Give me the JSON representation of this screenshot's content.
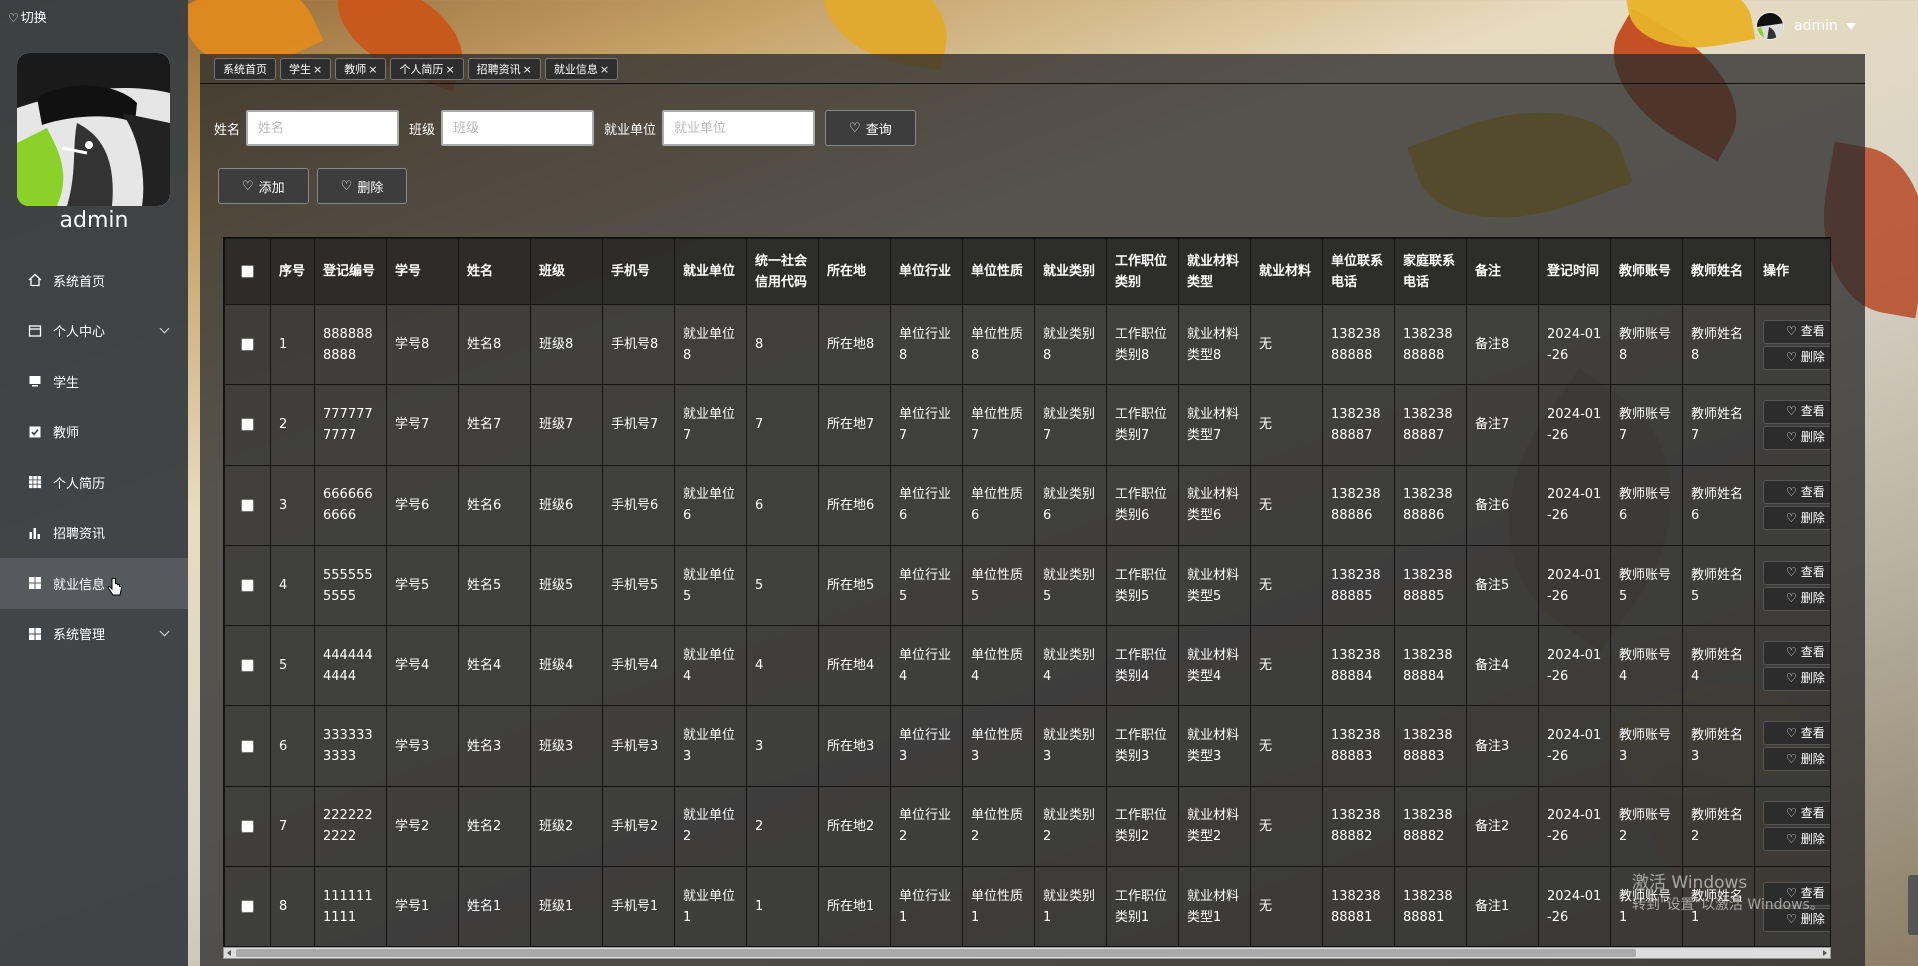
{
  "sidebar": {
    "switch_label": "切换",
    "username": "admin",
    "items": [
      {
        "label": "系统首页",
        "icon": "home-icon"
      },
      {
        "label": "个人中心",
        "icon": "profile-icon",
        "has_submenu": true
      },
      {
        "label": "学生",
        "icon": "monitor-icon"
      },
      {
        "label": "教师",
        "icon": "checkbox-icon"
      },
      {
        "label": "个人简历",
        "icon": "grid-icon"
      },
      {
        "label": "招聘资讯",
        "icon": "bar-chart-icon"
      },
      {
        "label": "就业信息",
        "icon": "apps-icon",
        "active": true
      },
      {
        "label": "系统管理",
        "icon": "apps-icon",
        "has_submenu": true
      }
    ]
  },
  "header": {
    "user": "admin"
  },
  "tabs": [
    "系统首页",
    "学生",
    "教师",
    "个人简历",
    "招聘资讯",
    "就业信息"
  ],
  "tab_close": "×",
  "search": {
    "name_label": "姓名",
    "name_placeholder": "姓名",
    "class_label": "班级",
    "class_placeholder": "班级",
    "employer_label": "就业单位",
    "employer_placeholder": "就业单位",
    "query_button": "查询"
  },
  "actions": {
    "add": "添加",
    "delete": "删除"
  },
  "table": {
    "headers": [
      "序号",
      "登记编号",
      "学号",
      "姓名",
      "班级",
      "手机号",
      "就业单位",
      "统一社会信用代码",
      "所在地",
      "单位行业",
      "单位性质",
      "就业类别",
      "工作职位类别",
      "就业材料类型",
      "就业材料",
      "单位联系电话",
      "家庭联系电话",
      "备注",
      "登记时间",
      "教师账号",
      "教师姓名",
      "操作"
    ],
    "view_label": "查看",
    "delete_label": "删除",
    "rows": [
      [
        "1",
        "8888888888",
        "学号8",
        "姓名8",
        "班级8",
        "手机号8",
        "就业单位8",
        "8",
        "所在地8",
        "单位行业8",
        "单位性质8",
        "就业类别8",
        "工作职位类别8",
        "就业材料类型8",
        "无",
        "13823888888",
        "13823888888",
        "备注8",
        "2024-01-26",
        "教师账号8",
        "教师姓名8"
      ],
      [
        "2",
        "7777777777",
        "学号7",
        "姓名7",
        "班级7",
        "手机号7",
        "就业单位7",
        "7",
        "所在地7",
        "单位行业7",
        "单位性质7",
        "就业类别7",
        "工作职位类别7",
        "就业材料类型7",
        "无",
        "13823888887",
        "13823888887",
        "备注7",
        "2024-01-26",
        "教师账号7",
        "教师姓名7"
      ],
      [
        "3",
        "6666666666",
        "学号6",
        "姓名6",
        "班级6",
        "手机号6",
        "就业单位6",
        "6",
        "所在地6",
        "单位行业6",
        "单位性质6",
        "就业类别6",
        "工作职位类别6",
        "就业材料类型6",
        "无",
        "13823888886",
        "13823888886",
        "备注6",
        "2024-01-26",
        "教师账号6",
        "教师姓名6"
      ],
      [
        "4",
        "5555555555",
        "学号5",
        "姓名5",
        "班级5",
        "手机号5",
        "就业单位5",
        "5",
        "所在地5",
        "单位行业5",
        "单位性质5",
        "就业类别5",
        "工作职位类别5",
        "就业材料类型5",
        "无",
        "13823888885",
        "13823888885",
        "备注5",
        "2024-01-26",
        "教师账号5",
        "教师姓名5"
      ],
      [
        "5",
        "4444444444",
        "学号4",
        "姓名4",
        "班级4",
        "手机号4",
        "就业单位4",
        "4",
        "所在地4",
        "单位行业4",
        "单位性质4",
        "就业类别4",
        "工作职位类别4",
        "就业材料类型4",
        "无",
        "13823888884",
        "13823888884",
        "备注4",
        "2024-01-26",
        "教师账号4",
        "教师姓名4"
      ],
      [
        "6",
        "3333333333",
        "学号3",
        "姓名3",
        "班级3",
        "手机号3",
        "就业单位3",
        "3",
        "所在地3",
        "单位行业3",
        "单位性质3",
        "就业类别3",
        "工作职位类别3",
        "就业材料类型3",
        "无",
        "13823888883",
        "13823888883",
        "备注3",
        "2024-01-26",
        "教师账号3",
        "教师姓名3"
      ],
      [
        "7",
        "2222222222",
        "学号2",
        "姓名2",
        "班级2",
        "手机号2",
        "就业单位2",
        "2",
        "所在地2",
        "单位行业2",
        "单位性质2",
        "就业类别2",
        "工作职位类别2",
        "就业材料类型2",
        "无",
        "13823888882",
        "13823888882",
        "备注2",
        "2024-01-26",
        "教师账号2",
        "教师姓名2"
      ],
      [
        "8",
        "1111111111",
        "学号1",
        "姓名1",
        "班级1",
        "手机号1",
        "就业单位1",
        "1",
        "所在地1",
        "单位行业1",
        "单位性质1",
        "就业类别1",
        "工作职位类别1",
        "就业材料类型1",
        "无",
        "13823888881",
        "13823888881",
        "备注1",
        "2024-01-26",
        "教师账号1",
        "教师姓名1"
      ]
    ]
  },
  "watermark": {
    "line1": "激活 Windows",
    "line2": "转到\"设置\"以激活 Windows。"
  }
}
